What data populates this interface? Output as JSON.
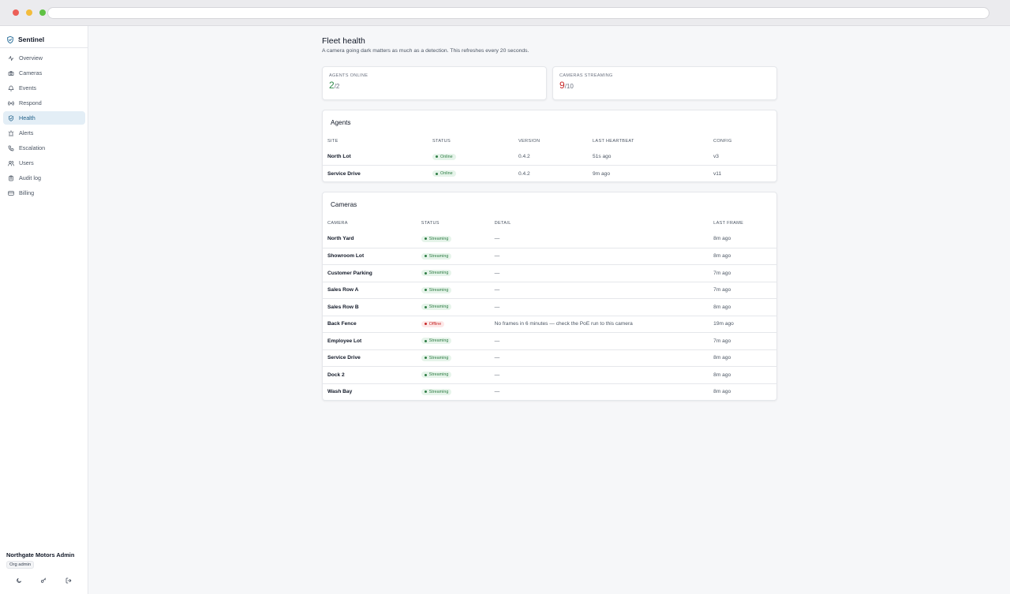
{
  "app": {
    "name": "Sentinel"
  },
  "sidebar": {
    "items": [
      {
        "label": "Overview",
        "icon": "activity-icon",
        "active": false
      },
      {
        "label": "Cameras",
        "icon": "camera-icon",
        "active": false
      },
      {
        "label": "Events",
        "icon": "bell-icon",
        "active": false
      },
      {
        "label": "Respond",
        "icon": "radio-icon",
        "active": false
      },
      {
        "label": "Health",
        "icon": "shield-icon",
        "active": true
      },
      {
        "label": "Alerts",
        "icon": "siren-icon",
        "active": false
      },
      {
        "label": "Escalation",
        "icon": "phone-icon",
        "active": false
      },
      {
        "label": "Users",
        "icon": "users-icon",
        "active": false
      },
      {
        "label": "Audit log",
        "icon": "clipboard-icon",
        "active": false
      },
      {
        "label": "Billing",
        "icon": "credit-card-icon",
        "active": false
      }
    ],
    "user": {
      "name": "Northgate Motors Admin",
      "role": "Org admin"
    },
    "footer_icons": [
      "moon-icon",
      "key-icon",
      "logout-icon"
    ]
  },
  "page": {
    "title": "Fleet health",
    "subtitle": "A camera going dark matters as much as a detection. This refreshes every 20 seconds."
  },
  "stats": {
    "agents": {
      "label": "Agents online",
      "value": "2",
      "total": "/2",
      "color": "#2f8a4a"
    },
    "cameras": {
      "label": "Cameras streaming",
      "value": "9",
      "total": "/10",
      "color": "#c62828"
    }
  },
  "agents": {
    "title": "Agents",
    "columns": [
      "Site",
      "Status",
      "Version",
      "Last heartbeat",
      "Config"
    ],
    "rows": [
      {
        "site": "North Lot",
        "status": "Online",
        "version": "0.4.2",
        "heartbeat": "51s ago",
        "config": "v3"
      },
      {
        "site": "Service Drive",
        "status": "Online",
        "version": "0.4.2",
        "heartbeat": "9m ago",
        "config": "v11"
      }
    ]
  },
  "cameras": {
    "title": "Cameras",
    "columns": [
      "Camera",
      "Status",
      "Detail",
      "Last frame"
    ],
    "rows": [
      {
        "name": "North Yard",
        "status": "Streaming",
        "ok": true,
        "detail": "—",
        "last": "8m ago"
      },
      {
        "name": "Showroom Lot",
        "status": "Streaming",
        "ok": true,
        "detail": "—",
        "last": "8m ago"
      },
      {
        "name": "Customer Parking",
        "status": "Streaming",
        "ok": true,
        "detail": "—",
        "last": "7m ago"
      },
      {
        "name": "Sales Row A",
        "status": "Streaming",
        "ok": true,
        "detail": "—",
        "last": "7m ago"
      },
      {
        "name": "Sales Row B",
        "status": "Streaming",
        "ok": true,
        "detail": "—",
        "last": "8m ago"
      },
      {
        "name": "Back Fence",
        "status": "Offline",
        "ok": false,
        "detail": "No frames in 6 minutes — check the PoE run to this camera",
        "last": "19m ago"
      },
      {
        "name": "Employee Lot",
        "status": "Streaming",
        "ok": true,
        "detail": "—",
        "last": "7m ago"
      },
      {
        "name": "Service Drive",
        "status": "Streaming",
        "ok": true,
        "detail": "—",
        "last": "8m ago"
      },
      {
        "name": "Dock 2",
        "status": "Streaming",
        "ok": true,
        "detail": "—",
        "last": "8m ago"
      },
      {
        "name": "Wash Bay",
        "status": "Streaming",
        "ok": true,
        "detail": "—",
        "last": "8m ago"
      }
    ]
  }
}
